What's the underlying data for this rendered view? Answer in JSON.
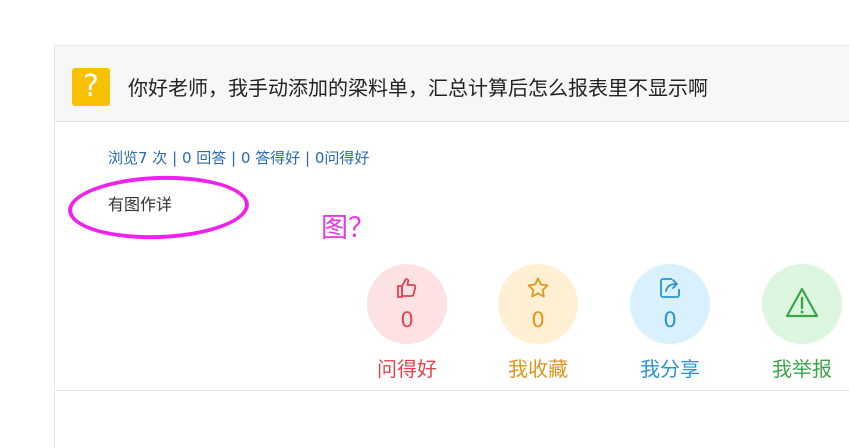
{
  "question": {
    "icon": "question-icon",
    "icon_glyph": "?",
    "title": "你好老师，我手动添加的梁料单，汇总计算后怎么报表里不显示啊"
  },
  "stats": {
    "views": "浏览7 次",
    "answers": "0 回答",
    "good_answers": "0 答得好",
    "good_questions": "0问得好",
    "separator": "|"
  },
  "body": {
    "text": "有图作详"
  },
  "annotation": {
    "text": "图？",
    "color": "#e23ae2"
  },
  "actions": [
    {
      "icon": "thumbs-up-icon",
      "count": "0",
      "label": "问得好",
      "color": "#e0454f",
      "bg": "#fde1e3"
    },
    {
      "icon": "star-icon",
      "count": "0",
      "label": "我收藏",
      "color": "#e0951e",
      "bg": "#fff0d3"
    },
    {
      "icon": "share-icon",
      "count": "0",
      "label": "我分享",
      "color": "#2a93d6",
      "bg": "#d9f0fd"
    },
    {
      "icon": "warning-icon",
      "count": "",
      "label": "我举报",
      "color": "#3aa64a",
      "bg": "#dcf6df"
    }
  ]
}
